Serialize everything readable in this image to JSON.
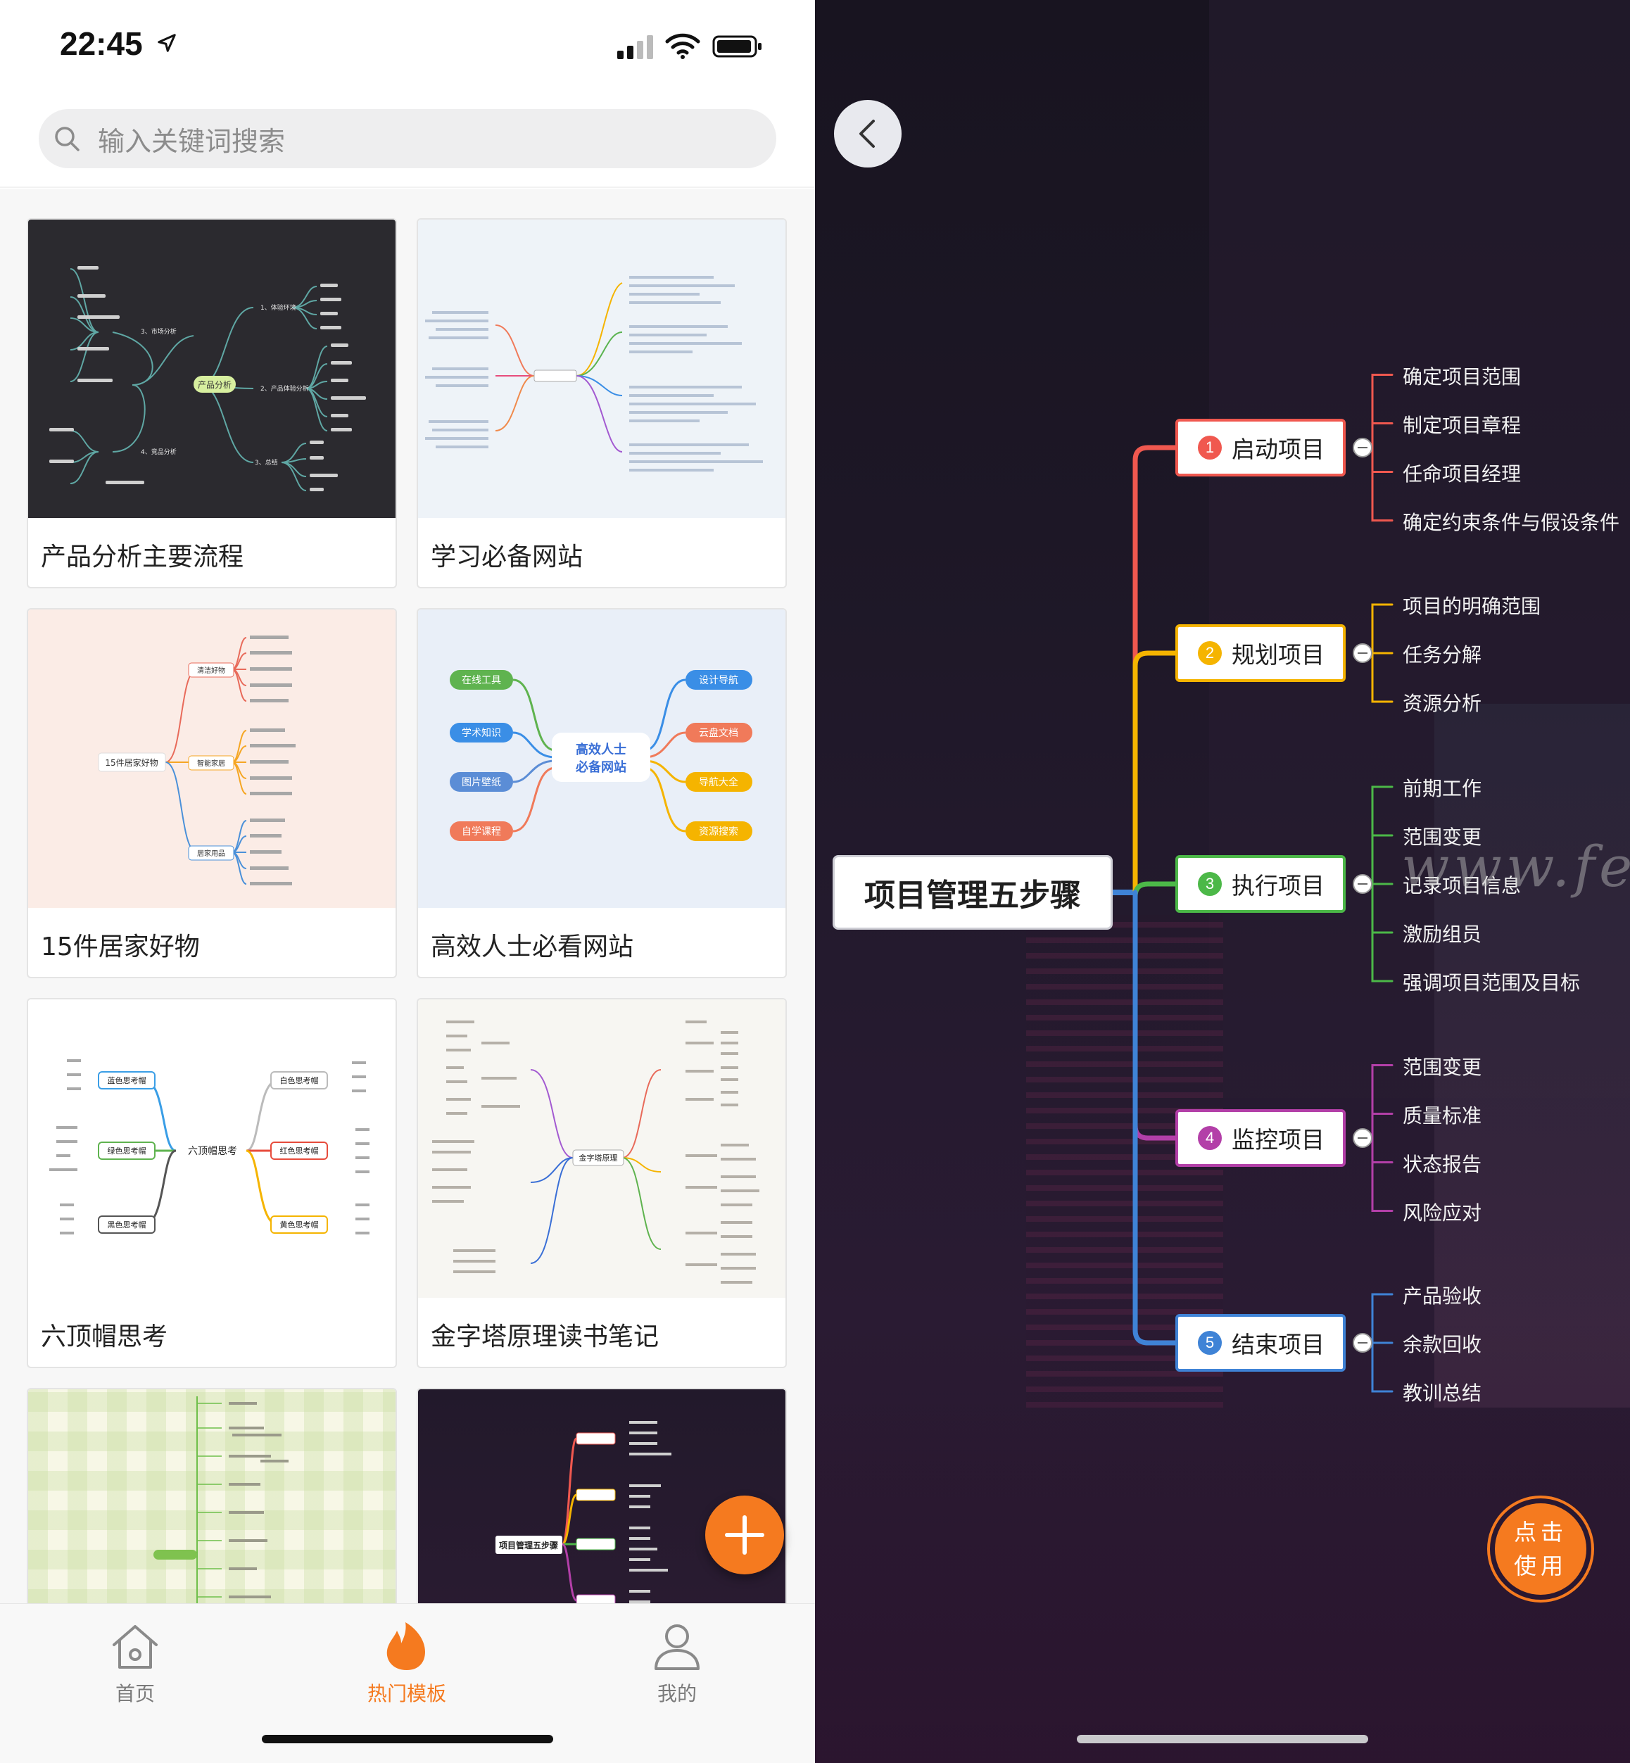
{
  "status_bar": {
    "time": "22:45"
  },
  "search": {
    "placeholder": "输入关键词搜索"
  },
  "templates": [
    {
      "title": "产品分析主要流程"
    },
    {
      "title": "学习必备网站"
    },
    {
      "title": "15件居家好物"
    },
    {
      "title": "高效人士必看网站"
    },
    {
      "title": "六顶帽思考"
    },
    {
      "title": "金字塔原理读书笔记"
    }
  ],
  "thumbs": {
    "product_analysis": {
      "center": "产品分析",
      "branches": [
        "1、体验环境",
        "2、产品体验分析",
        "3、总结",
        "3、市场分析",
        "4、竞品分析"
      ]
    },
    "home_goods": {
      "center": "15件居家好物",
      "branches": [
        "清洁好物",
        "智能家居",
        "居家用品"
      ]
    },
    "efficient": {
      "center_line1": "高效人士",
      "center_line2": "必备网站",
      "left": [
        "在线工具",
        "学术知识",
        "图片壁纸",
        "自学课程"
      ],
      "right": [
        "设计导航",
        "云盘文档",
        "导航大全",
        "资源搜索"
      ]
    },
    "six_hats": {
      "center": "六顶帽思考",
      "hats": [
        "蓝色思考帽",
        "绿色思考帽",
        "黑色思考帽",
        "白色思考帽",
        "红色思考帽",
        "黄色思考帽"
      ]
    },
    "pyramid": {
      "center": "金字塔原理"
    },
    "project_mini": {
      "center": "项目管理五步骤"
    }
  },
  "tabbar": {
    "tabs": [
      {
        "label": "首页"
      },
      {
        "label": "热门模板"
      },
      {
        "label": "我的"
      }
    ]
  },
  "detail": {
    "watermark": "www.fenonla.cn",
    "root": "项目管理五步骤",
    "branches": [
      {
        "num": "1",
        "label": "启动项目",
        "color": "#f0584f",
        "leaves": [
          "确定项目范围",
          "制定项目章程",
          "任命项目经理",
          "确定约束条件与假设条件"
        ]
      },
      {
        "num": "2",
        "label": "规划项目",
        "color": "#f5b400",
        "leaves": [
          "项目的明确范围",
          "任务分解",
          "资源分析"
        ]
      },
      {
        "num": "3",
        "label": "执行项目",
        "color": "#4cb848",
        "leaves": [
          "前期工作",
          "范围变更",
          "记录项目信息",
          "激励组员",
          "强调项目范围及目标"
        ]
      },
      {
        "num": "4",
        "label": "监控项目",
        "color": "#b33fa8",
        "leaves": [
          "范围变更",
          "质量标准",
          "状态报告",
          "风险应对"
        ]
      },
      {
        "num": "5",
        "label": "结束项目",
        "color": "#3f83d6",
        "leaves": [
          "产品验收",
          "余款回收",
          "教训总结"
        ]
      }
    ],
    "use_button": {
      "line1": "点击",
      "line2": "使用"
    },
    "accent": "#f57a1f"
  }
}
